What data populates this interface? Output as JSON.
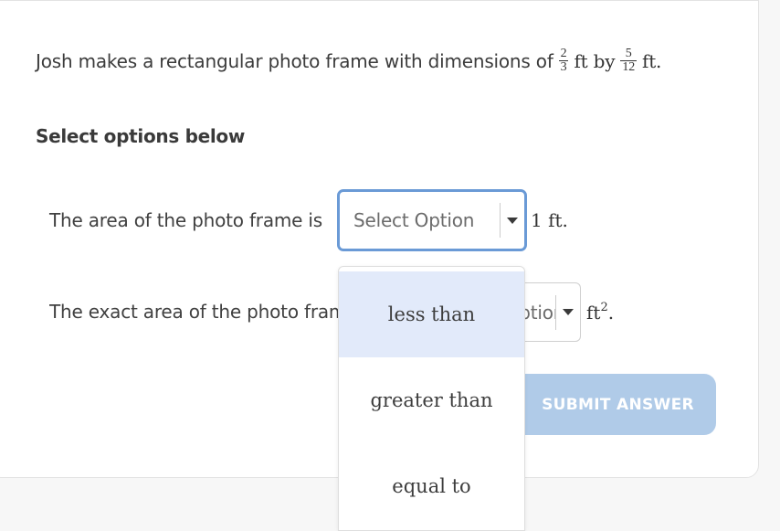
{
  "question": {
    "text_before": "Josh makes a rectangular photo frame with dimensions of",
    "frac1": {
      "numerator": "2",
      "denominator": "3"
    },
    "unit1": "ft by",
    "frac2": {
      "numerator": "5",
      "denominator": "12"
    },
    "unit2": "ft."
  },
  "section_title": "Select options below",
  "rows": [
    {
      "label": "The area of the photo frame is",
      "select_value": "Select Option",
      "suffix": "1 ft."
    },
    {
      "label": "The exact area of the photo frame is",
      "select_value": "Select Option",
      "suffix_base": "ft",
      "suffix_exp": "2",
      "suffix_end": "."
    }
  ],
  "dropdown": {
    "options": [
      "less than",
      "greater than",
      "equal to"
    ],
    "highlighted": "less than"
  },
  "submit_label": "SUBMIT ANSWER",
  "colors": {
    "select_focus_border": "#6a9ad6",
    "option_highlight": "#e2eafa",
    "submit_bg": "#b0cbe8"
  }
}
